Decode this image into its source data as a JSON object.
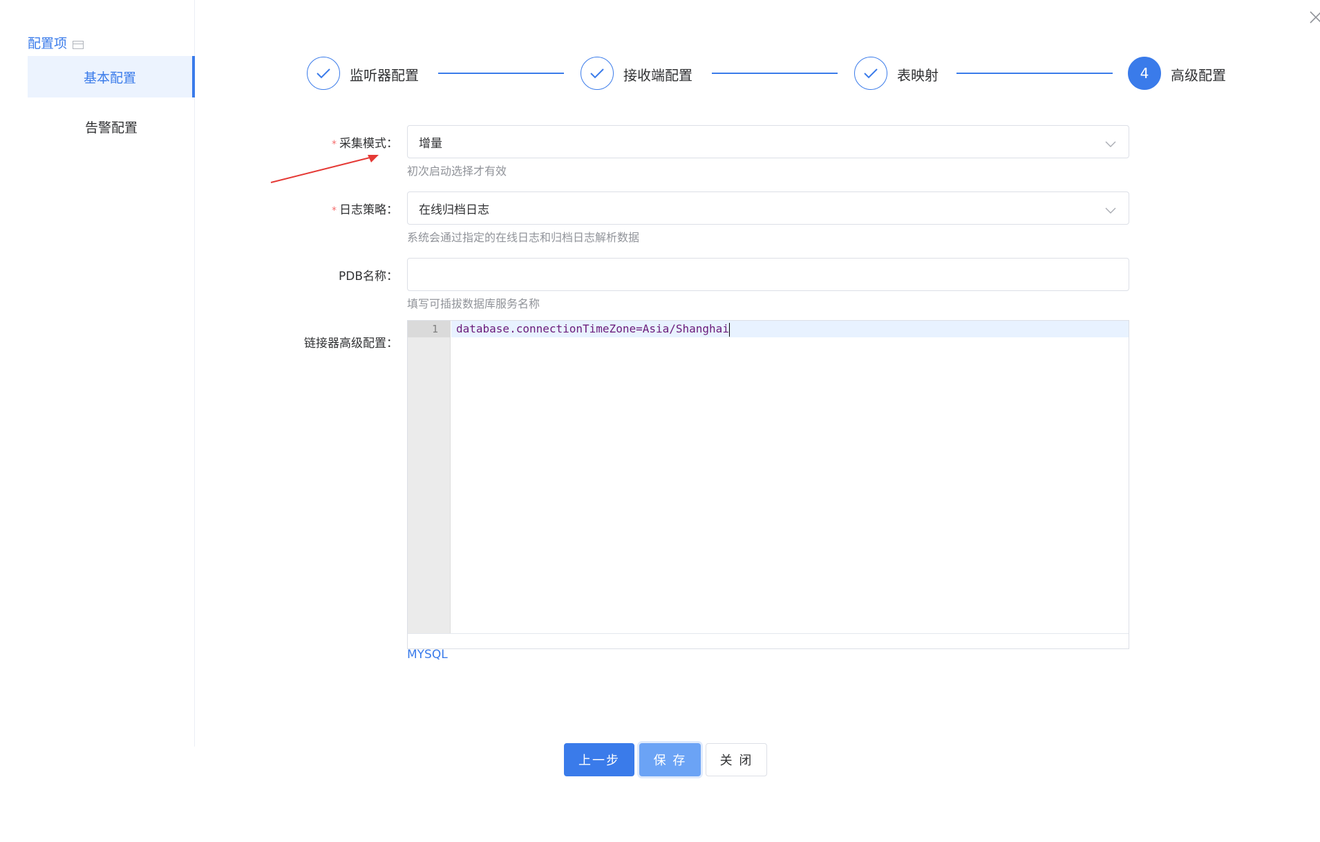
{
  "sidebar": {
    "title": "配置项",
    "items": [
      {
        "label": "基本配置",
        "active": true
      },
      {
        "label": "告警配置",
        "active": false
      }
    ]
  },
  "steps": [
    {
      "label": "监听器配置",
      "status": "done",
      "mark": "check-icon"
    },
    {
      "label": "接收端配置",
      "status": "done",
      "mark": "check-icon"
    },
    {
      "label": "表映射",
      "status": "done",
      "mark": "check-icon"
    },
    {
      "label": "高级配置",
      "status": "current",
      "number": "4"
    }
  ],
  "form": {
    "required_mark": "*",
    "collect_mode": {
      "label": "采集模式：",
      "value": "增量",
      "hint": "初次启动选择才有效"
    },
    "log_strategy": {
      "label": "日志策略：",
      "value": "在线归档日志",
      "hint": "系统会通过指定的在线日志和归档日志解析数据"
    },
    "pdb_name": {
      "label": "PDB名称：",
      "value": "",
      "hint": "填写可插拔数据库服务名称"
    },
    "connector_advanced": {
      "label": "链接器高级配置：",
      "line_number": "1",
      "code": "database.connectionTimeZone=Asia/Shanghai",
      "mode": "MYSQL"
    }
  },
  "buttons": {
    "prev": "上一步",
    "save": "保 存",
    "close": "关 闭"
  },
  "colors": {
    "accent": "#3a7bea",
    "required": "#f56c6c",
    "annotation_arrow": "#e53935"
  }
}
